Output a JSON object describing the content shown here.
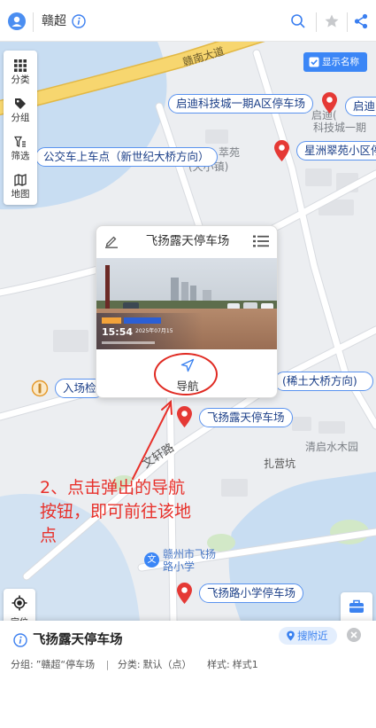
{
  "topbar": {
    "title": "赣超",
    "avatar_icon": "user-icon",
    "info_icon": "info-icon",
    "search_icon": "search-icon",
    "favorite_icon": "star-icon",
    "share_icon": "share-icon"
  },
  "map_toolbar": {
    "items": [
      {
        "label": "分类",
        "icon": "grid-icon"
      },
      {
        "label": "分组",
        "icon": "tag-icon"
      },
      {
        "label": "筛选",
        "icon": "filter-icon"
      },
      {
        "label": "地图",
        "icon": "map-icon"
      }
    ],
    "show_names": "显示名称",
    "locate": "定位",
    "tools": "工具"
  },
  "map": {
    "road_labels": {
      "main": "赣南大道",
      "wenxuan": "文轩路"
    },
    "place_labels": {
      "qidi_line1": "启迪(",
      "qidi_line2": "科技城一期",
      "cuiyuan": "萃苑",
      "tianxiao": "(天小镇)",
      "qingqi": "清启水木园",
      "zhaying": "扎营坑",
      "school_line1": "赣州市飞扬",
      "school_line2": "路小学",
      "school_icon_glyph": "文"
    },
    "pins": [
      {
        "label": "启迪科技城一期A区停车场"
      },
      {
        "label": "启迪"
      },
      {
        "label": "公交车上车点（新世纪大桥方向）"
      },
      {
        "label": "星洲翠苑小区停"
      },
      {
        "label": "入场检"
      },
      {
        "label": "(稀土大桥方向)"
      },
      {
        "label": "飞扬露天停车场"
      },
      {
        "label": "飞扬路小学停车场"
      }
    ]
  },
  "popup": {
    "title": "飞扬露天停车场",
    "edit_icon": "pencil-icon",
    "list_icon": "list-icon",
    "navigate": "导航",
    "navigate_icon": "navigation-arrow-icon",
    "photo": {
      "time": "15:54",
      "date": "2025年07月15"
    }
  },
  "annotation": {
    "lines": [
      "2、点击弹出的导航",
      "按钮，即可前往该地",
      "点"
    ]
  },
  "detail_panel": {
    "title": "飞扬露天停车场",
    "search_nearby": "搜附近",
    "group_label": "分组:",
    "group_value": "”赣超“停车场",
    "separator": "|",
    "category_label": "分类:",
    "category_value": "默认（点）",
    "style_label": "样式:",
    "style_value": "样式1"
  },
  "colors": {
    "accent": "#3b82f0",
    "pin": "#e53935",
    "annotation": "#e8302a",
    "water": "#c5dcf2",
    "main_road": "#f7d66f"
  }
}
